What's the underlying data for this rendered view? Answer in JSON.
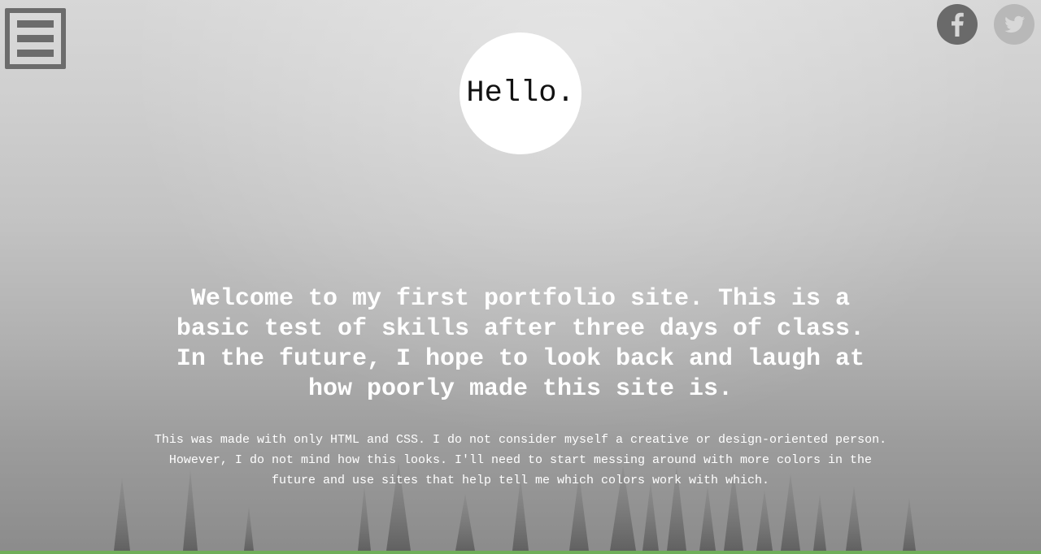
{
  "nav": {
    "menu_icon": "hamburger-menu-icon"
  },
  "social": {
    "facebook": {
      "icon": "facebook-icon",
      "glyph": "f",
      "color": "#6a6a6a"
    },
    "twitter": {
      "icon": "twitter-icon",
      "color": "#b8b8b8"
    }
  },
  "hero": {
    "greeting": "Hello.",
    "headline": "Welcome to my first portfolio site. This is a basic test of skills after three days of class. In the future, I hope to look back and laugh at how poorly made this site is.",
    "body": "This was made with only HTML and CSS. I do not consider myself a creative or design-oriented person. However, I do not mind how this looks. I'll need to start messing around with more colors in the future and use sites that help tell me which colors work with which."
  },
  "colors": {
    "text": "#ffffff",
    "greeting_circle": "#ffffff",
    "bottom_strip": "#6fae5a"
  }
}
